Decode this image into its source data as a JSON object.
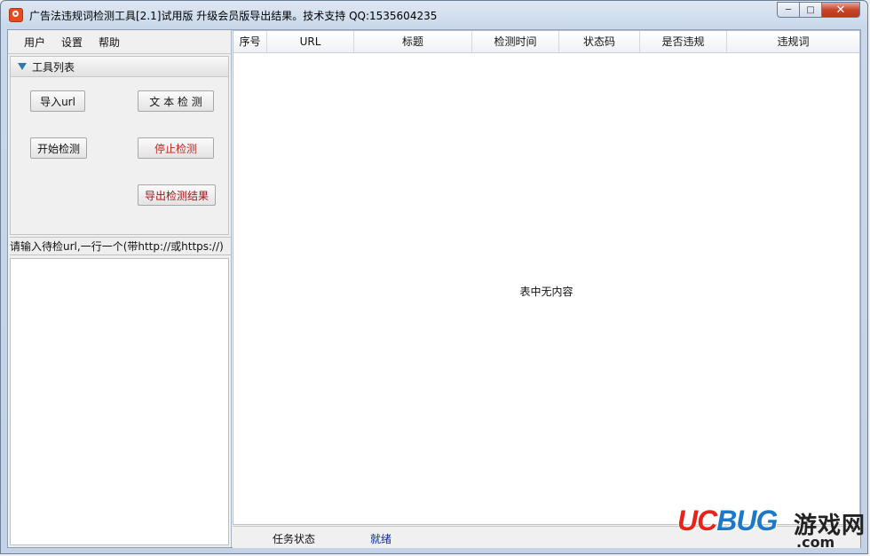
{
  "window": {
    "title": "广告法违规词检测工具[2.1]试用版 升级会员版导出结果。技术支持 QQ:1535604235",
    "minimize_label": "─",
    "maximize_label": "□",
    "close_label": "✕"
  },
  "menu": {
    "items": [
      "用户",
      "设置",
      "帮助"
    ]
  },
  "tool_panel": {
    "header": "工具列表",
    "import_url": "导入url",
    "text_check": "文 本 检 测",
    "start_check": "开始检测",
    "stop_check": "停止检测",
    "export_results": "导出检测结果"
  },
  "url_input": {
    "label": "请输入待检url,一行一个(带http://或https://)",
    "value": ""
  },
  "table": {
    "columns": [
      "序号",
      "URL",
      "标题",
      "检测时间",
      "状态码",
      "是否违规",
      "违规词"
    ],
    "rows": [],
    "empty_message": "表中无内容"
  },
  "status": {
    "label": "任务状态",
    "value": "就绪"
  },
  "watermark": {
    "logo_red": "UC",
    "logo_blue": "BUG",
    "cn": "游戏网",
    "domain": ".com"
  },
  "colors": {
    "accent_red": "#c0241d",
    "status_blue": "#0a2a9c",
    "tree_icon": "#2b7ca8"
  }
}
